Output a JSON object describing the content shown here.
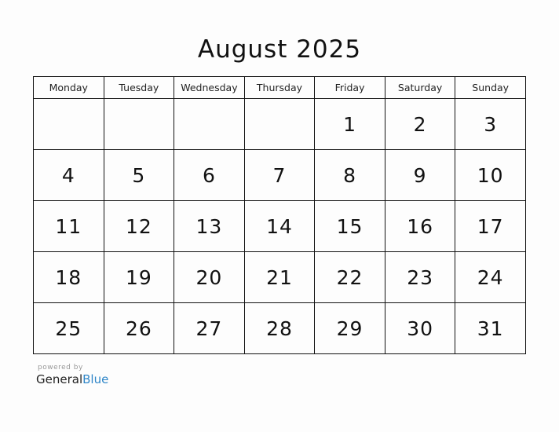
{
  "calendar": {
    "title": "August 2025",
    "weekdays": [
      "Monday",
      "Tuesday",
      "Wednesday",
      "Thursday",
      "Friday",
      "Saturday",
      "Sunday"
    ],
    "weeks": [
      [
        "",
        "",
        "",
        "",
        "1",
        "2",
        "3"
      ],
      [
        "4",
        "5",
        "6",
        "7",
        "8",
        "9",
        "10"
      ],
      [
        "11",
        "12",
        "13",
        "14",
        "15",
        "16",
        "17"
      ],
      [
        "18",
        "19",
        "20",
        "21",
        "22",
        "23",
        "24"
      ],
      [
        "25",
        "26",
        "27",
        "28",
        "29",
        "30",
        "31"
      ]
    ]
  },
  "footer": {
    "powered_by": "powered by",
    "brand_part1": "General",
    "brand_part2": "Blue"
  }
}
